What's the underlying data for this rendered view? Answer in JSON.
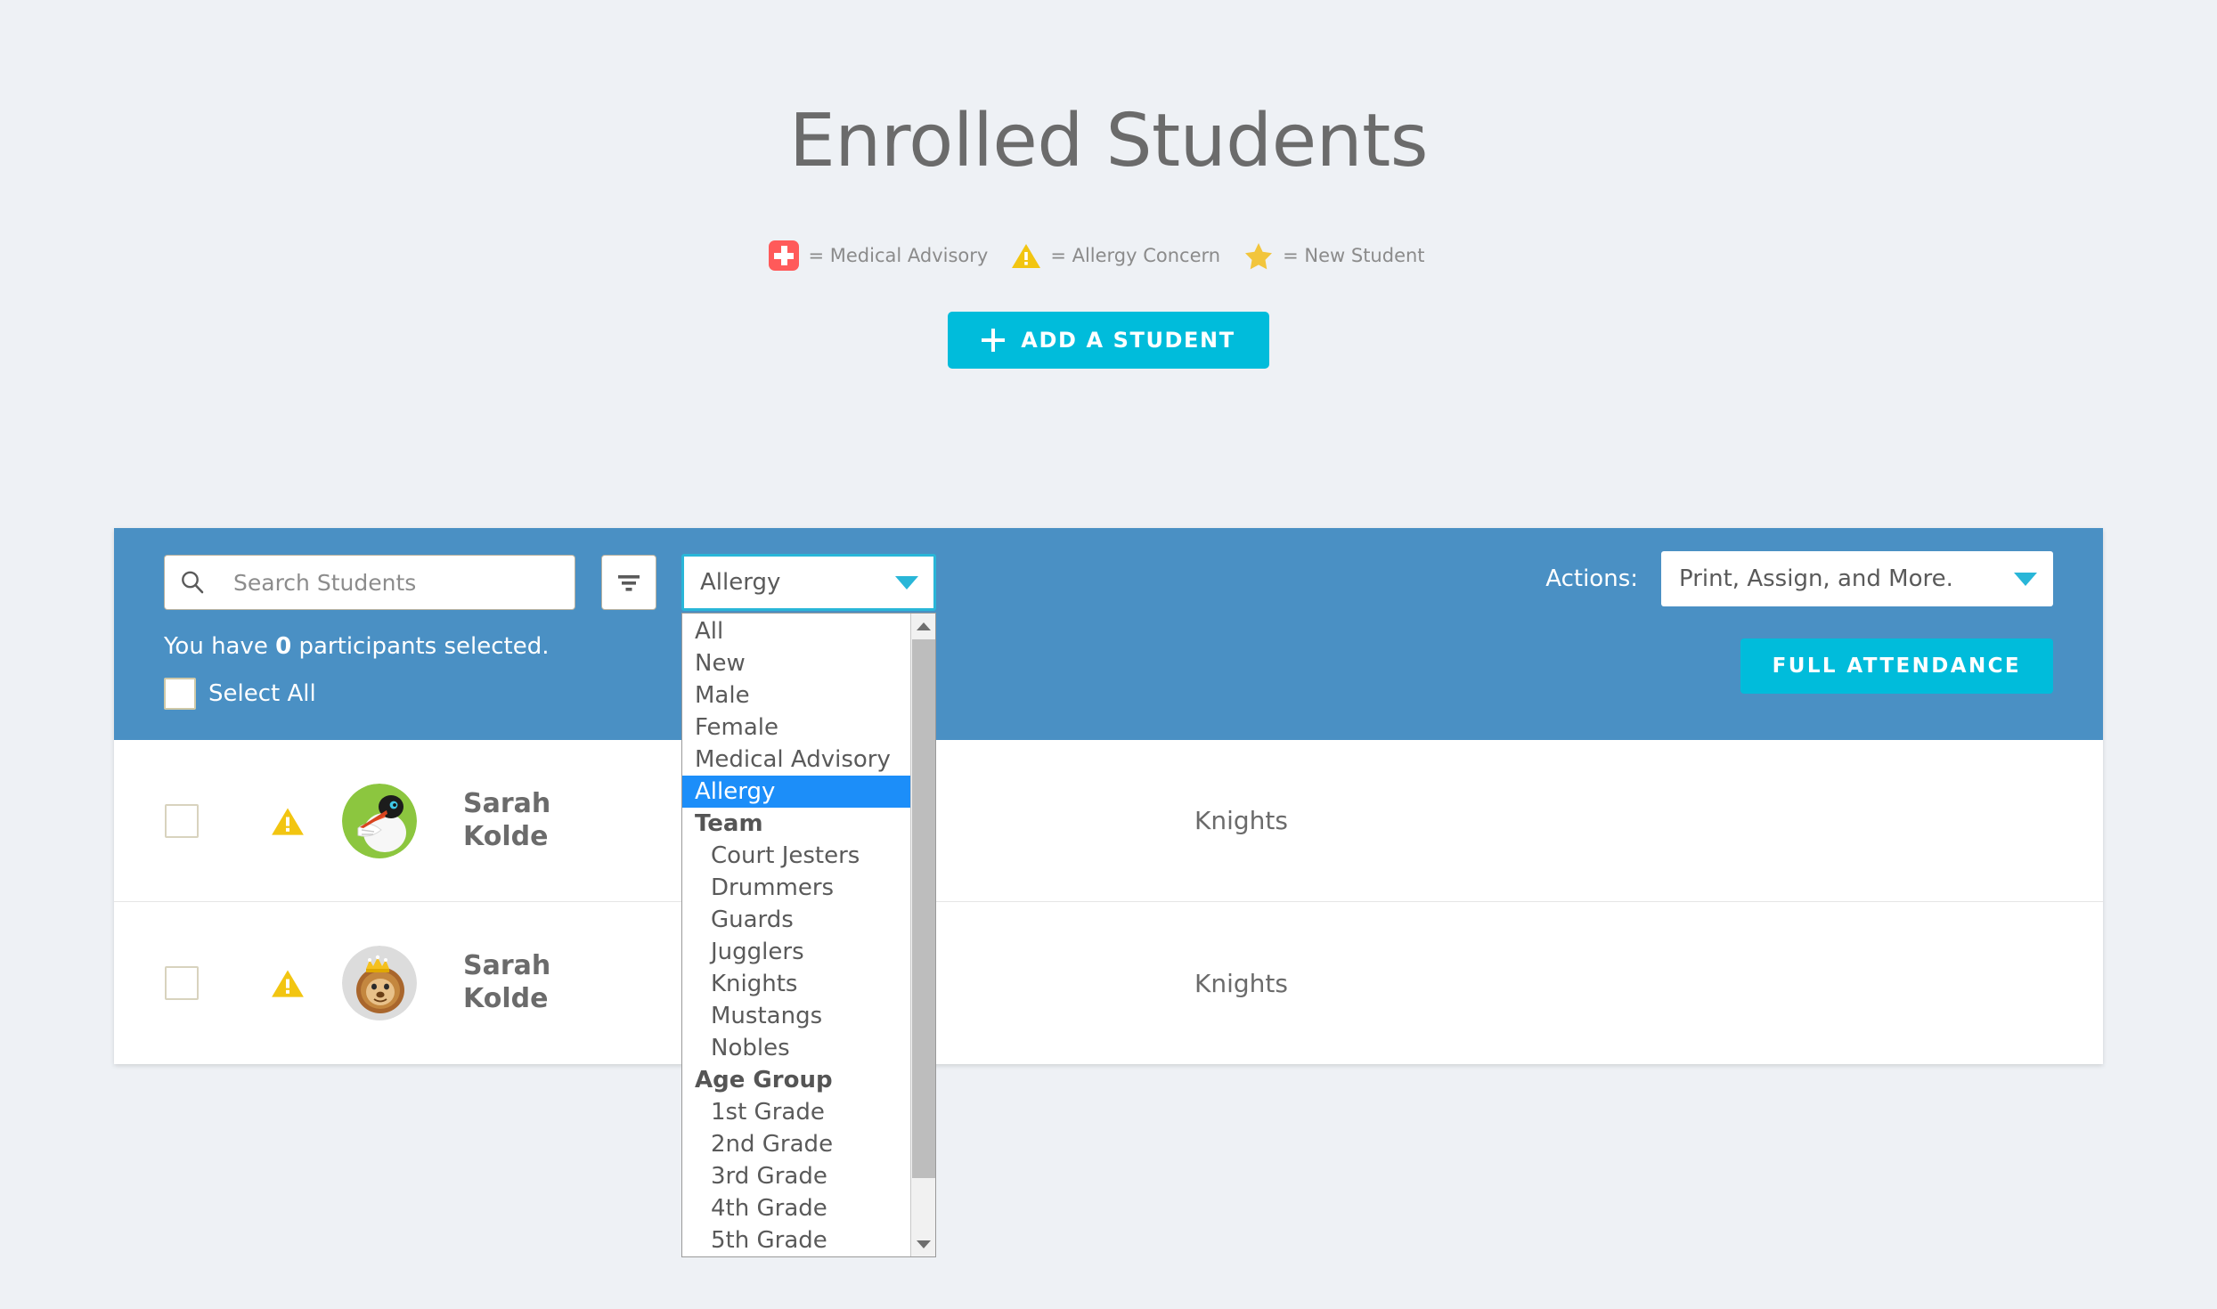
{
  "page": {
    "title": "Enrolled Students"
  },
  "legend": [
    {
      "icon": "medical-cross-icon",
      "text": "= Medical Advisory"
    },
    {
      "icon": "warning-triangle-icon",
      "text": "= Allergy Concern"
    },
    {
      "icon": "star-icon",
      "text": "= New Student"
    }
  ],
  "add_student_button": {
    "label": "ADD A STUDENT",
    "icon": "plus-icon",
    "color": "#00bcdb"
  },
  "toolbar": {
    "search": {
      "placeholder": "Search Students",
      "value": "",
      "icon": "search-icon"
    },
    "filter_icon": "filter-lines-icon",
    "filter_select": {
      "value": "Allergy",
      "open": true,
      "options": [
        {
          "label": "All",
          "type": "option"
        },
        {
          "label": "New",
          "type": "option"
        },
        {
          "label": "Male",
          "type": "option"
        },
        {
          "label": "Female",
          "type": "option"
        },
        {
          "label": "Medical Advisory",
          "type": "option"
        },
        {
          "label": "Allergy",
          "type": "option",
          "selected": true
        },
        {
          "label": "Team",
          "type": "group"
        },
        {
          "label": "Court Jesters",
          "type": "option",
          "indent": true
        },
        {
          "label": "Drummers",
          "type": "option",
          "indent": true
        },
        {
          "label": "Guards",
          "type": "option",
          "indent": true
        },
        {
          "label": "Jugglers",
          "type": "option",
          "indent": true
        },
        {
          "label": "Knights",
          "type": "option",
          "indent": true
        },
        {
          "label": "Mustangs",
          "type": "option",
          "indent": true
        },
        {
          "label": "Nobles",
          "type": "option",
          "indent": true
        },
        {
          "label": "Age Group",
          "type": "group"
        },
        {
          "label": "1st Grade",
          "type": "option",
          "indent": true
        },
        {
          "label": "2nd Grade",
          "type": "option",
          "indent": true
        },
        {
          "label": "3rd Grade",
          "type": "option",
          "indent": true
        },
        {
          "label": "4th Grade",
          "type": "option",
          "indent": true
        },
        {
          "label": "5th Grade",
          "type": "option",
          "indent": true
        }
      ]
    },
    "actions_label": "Actions:",
    "actions_select": {
      "value": "Print, Assign, and More."
    },
    "selection_prefix": "You have ",
    "selection_count": "0",
    "selection_suffix": " participants selected.",
    "select_all_label": "Select All",
    "full_attendance_label": "FULL ATTENDANCE",
    "accent_color": "#00bcdb",
    "bar_color": "#4a90c4"
  },
  "students": [
    {
      "flag": "warning-triangle-icon",
      "avatar": "stork-avatar",
      "first_name": "Sarah",
      "last_name": "Kolde",
      "team": "Knights"
    },
    {
      "flag": "warning-triangle-icon",
      "avatar": "lion-king-avatar",
      "first_name": "Sarah",
      "last_name": "Kolde",
      "team": "Knights"
    }
  ]
}
